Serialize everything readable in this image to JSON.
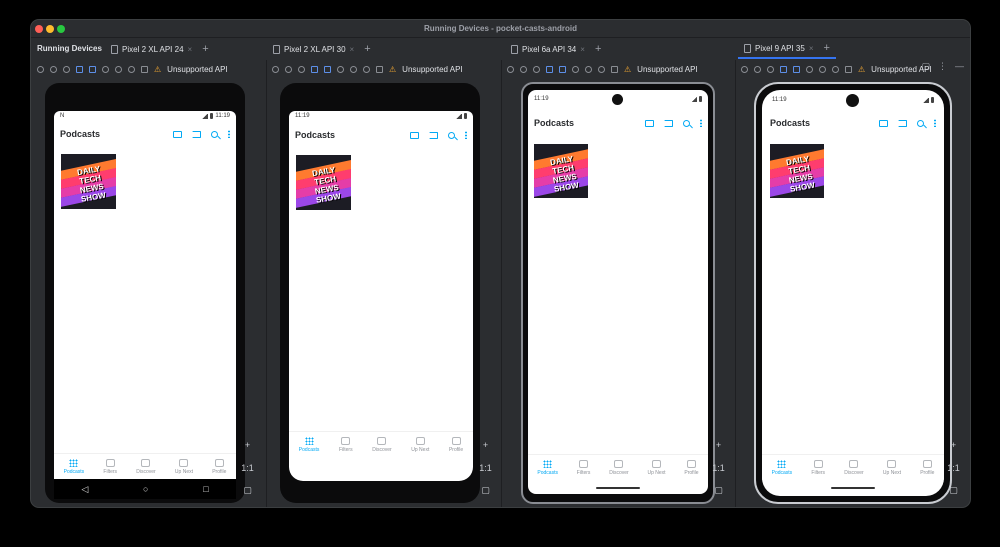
{
  "window": {
    "title": "Running Devices - pocket-casts-android"
  },
  "panel": {
    "label": "Running Devices"
  },
  "devices": [
    {
      "tab": "Pixel 2 XL API 24",
      "time": "11:19",
      "indicator": "N"
    },
    {
      "tab": "Pixel 2 XL API 30",
      "time": "11:19",
      "indicator": ""
    },
    {
      "tab": "Pixel 6a API 34",
      "time": "11:19",
      "indicator": ""
    },
    {
      "tab": "Pixel 9 API 35",
      "time": "11:19",
      "indicator": ""
    }
  ],
  "toolbar": {
    "warning": "Unsupported API"
  },
  "side": {
    "plus": "+",
    "ratio": "1:1"
  },
  "app": {
    "title": "Podcasts",
    "artwork_text": "DAILY TECH NEWS SHOW",
    "nav": [
      "Podcasts",
      "Filters",
      "Discover",
      "Up Next",
      "Profile"
    ]
  },
  "sysnav": {
    "back": "◁",
    "home": "○",
    "recents": "□"
  },
  "colors": {
    "accent": "#03a9f4",
    "ide_bg": "#2b2d30",
    "active_tab": "#3574f0"
  }
}
